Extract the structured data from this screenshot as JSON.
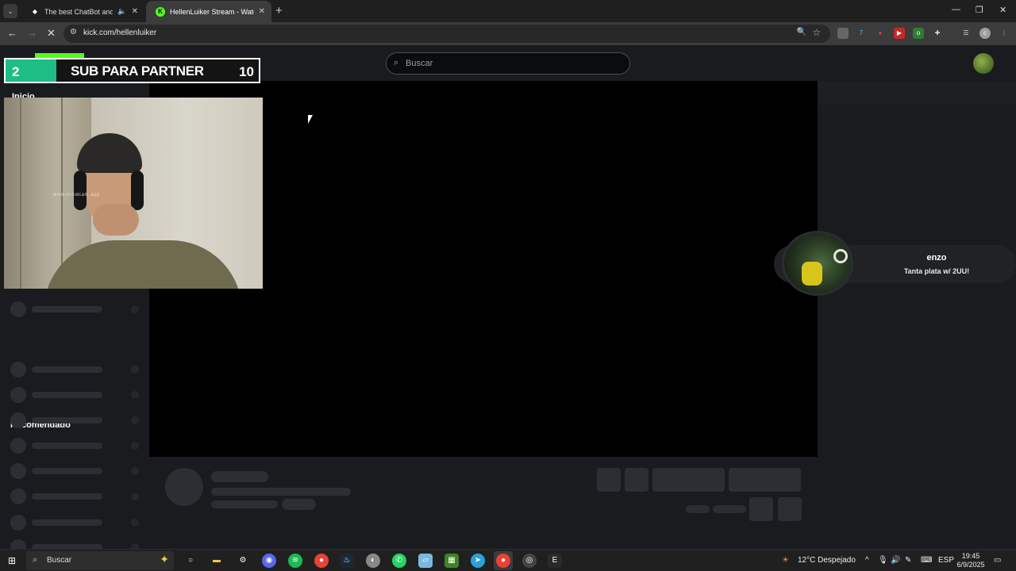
{
  "browser": {
    "tabs": [
      {
        "title": "The best ChatBot and Widg",
        "active": false
      },
      {
        "title": "HellenLuiker Stream - Watch Li",
        "active": true
      }
    ],
    "url": "kick.com/hellenluiker"
  },
  "site": {
    "search_placeholder": "Buscar",
    "sidebar_home": "Inicio",
    "sidebar_recommended": "Recomendado"
  },
  "overlay": {
    "goal": {
      "current": "2",
      "label": "SUB PARA PARTNER",
      "target": "10",
      "progress": 0.2,
      "color": "#1fbd86"
    },
    "webcam_watermark": "www.droidcam.app",
    "alert": {
      "name": "enzo",
      "message": "Tanta plata w/ 2UU!"
    }
  },
  "taskbar": {
    "search_placeholder": "Buscar",
    "weather": "12°C  Despejado",
    "language": "ESP",
    "time": "19:45",
    "date": "6/9/2025"
  },
  "colors": {
    "kick_green": "#53fc18",
    "background": "#191b1f"
  }
}
